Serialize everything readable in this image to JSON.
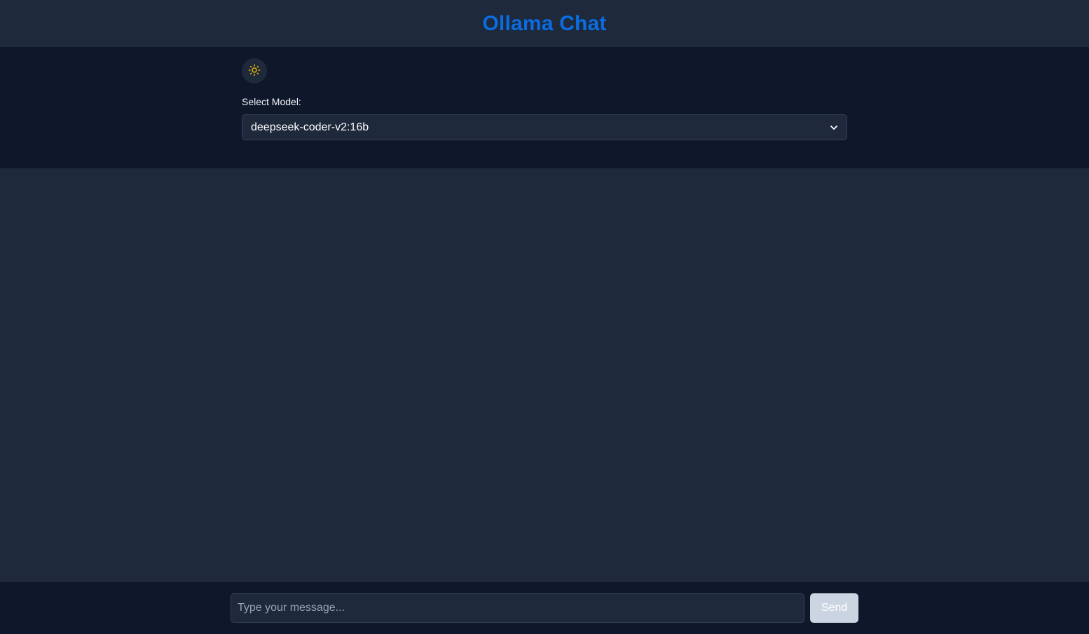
{
  "header": {
    "title": "Ollama Chat"
  },
  "controls": {
    "theme_toggle_icon": "sun-icon",
    "model_label": "Select Model:",
    "model_selected": "deepseek-coder-v2:16b"
  },
  "composer": {
    "placeholder": "Type your message...",
    "value": "",
    "send_label": "Send"
  },
  "colors": {
    "accent": "#0a6ce0",
    "sun_icon": "#eab308",
    "background": "#1e293b",
    "panel": "#0f172a",
    "send_button_disabled": "#cbd5e1"
  }
}
